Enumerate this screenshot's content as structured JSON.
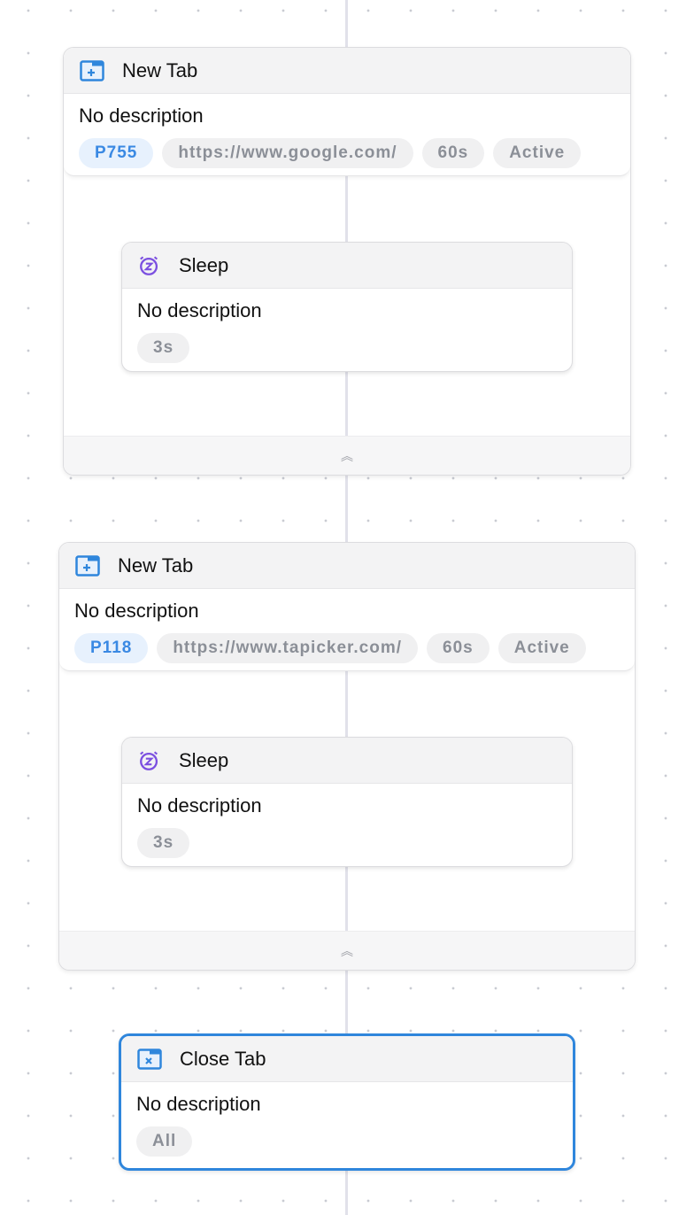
{
  "groups": [
    {
      "title": "New Tab",
      "icon": "new-tab-icon",
      "description": "No description",
      "tags": [
        "P755",
        "https://www.google.com/",
        "60s",
        "Active"
      ],
      "child": {
        "title": "Sleep",
        "icon": "sleep-alarm-icon",
        "description": "No description",
        "tags": [
          "3s"
        ]
      }
    },
    {
      "title": "New Tab",
      "icon": "new-tab-icon",
      "description": "No description",
      "tags": [
        "P118",
        "https://www.tapicker.com/",
        "60s",
        "Active"
      ],
      "child": {
        "title": "Sleep",
        "icon": "sleep-alarm-icon",
        "description": "No description",
        "tags": [
          "3s"
        ]
      }
    }
  ],
  "close_tab": {
    "title": "Close Tab",
    "icon": "close-tab-icon",
    "description": "No description",
    "tags": [
      "All"
    ],
    "selected": true
  },
  "colors": {
    "accent": "#2f86dc",
    "tab_icon": "#2f86dc",
    "sleep_icon": "#7b4fe0",
    "connector": "#e1e1ea"
  }
}
